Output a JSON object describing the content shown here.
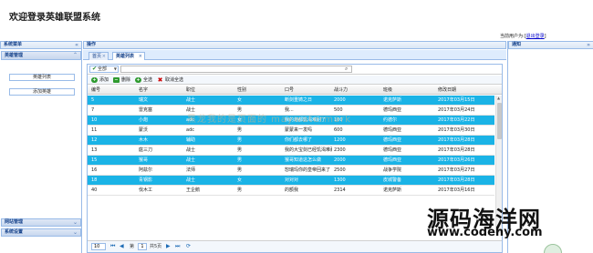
{
  "header": {
    "title": "欢迎登录英雄联盟系统",
    "user_prefix": "当前用户为:",
    "user_bracket_open": "[",
    "logout": "退出登录",
    "user_bracket_close": "]"
  },
  "sidebar": {
    "nav_title": "系统菜单",
    "hero_menu": "英雄管理",
    "links": [
      "英雄列表",
      "添加英雄"
    ],
    "skill_menu": "网站管理",
    "sys_menu": "系统设置"
  },
  "center": {
    "title": "操作",
    "tabs": [
      "首页",
      "英雄列表"
    ],
    "filter": {
      "value": "全部"
    },
    "toolbar": {
      "add": "添加",
      "delete": "删除",
      "select_all": "全选",
      "cancel": "取消全选"
    },
    "columns": [
      "编号",
      "名字",
      "职位",
      "性别",
      "口号",
      "战斗力",
      "班级",
      "修改日期"
    ],
    "rows": [
      [
        "5",
        "瑞文",
        "战士",
        "女",
        "断剑重铸之日",
        "2000",
        "诺克萨斯",
        "2017年03月15日",
        true
      ],
      [
        "7",
        "雷克塞",
        "战士",
        "男",
        "我...",
        "500",
        "德玛西亚",
        "2017年03月24日",
        false
      ],
      [
        "10",
        "小炮",
        "adc",
        "女",
        "我的炮都饥渴难耐了",
        "100",
        "约德尔",
        "2017年03月22日",
        true
      ],
      [
        "11",
        "蒙沃",
        "adc",
        "男",
        "蒙蒙来一发吗",
        "600",
        "德玛西亚",
        "2017年03月30日",
        false
      ],
      [
        "12",
        "木木",
        "辅助",
        "男",
        "你们都去哪了",
        "1200",
        "德玛西亚",
        "2017年03月28日",
        true
      ],
      [
        "13",
        "庭三刀",
        "战士",
        "男",
        "我的大宝剑已经饥渴难耐",
        "2300",
        "德玛西亚",
        "2017年03月28日",
        false
      ],
      [
        "15",
        "猴哥",
        "战士",
        "男",
        "猴哥知道这怎么做",
        "2000",
        "德玛西亚",
        "2017年03月26日",
        true
      ],
      [
        "16",
        "阿兹尔",
        "法师",
        "男",
        "恕瑞玛你的皇帝回来了",
        "2500",
        "战争学院",
        "2017年03月27日",
        false
      ],
      [
        "18",
        "青钢影",
        "战士",
        "女",
        "对对对",
        "1300",
        "皮城警备",
        "2017年03月28日",
        true
      ],
      [
        "40",
        "伐木工",
        "王企鹅",
        "男",
        "的额我",
        "2314",
        "诺克萨斯",
        "2017年03月16日",
        false
      ]
    ],
    "pager": {
      "size": "10",
      "page_label": "第",
      "page": "1",
      "total": "共5页"
    }
  },
  "right": {
    "title": "通知"
  },
  "watermark": {
    "cn": "源码海洋网",
    "url": "www.codehy.com",
    "faint": "黑龙我的是页面的 maywatermark"
  }
}
